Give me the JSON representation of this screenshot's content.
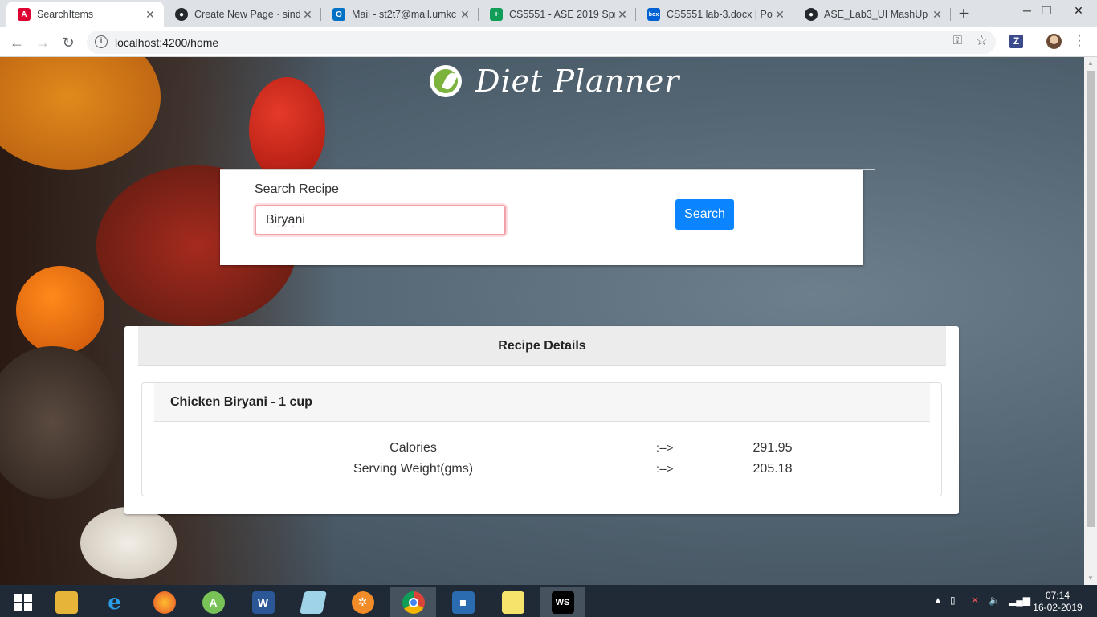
{
  "browser": {
    "tabs": [
      {
        "title": "SearchItems",
        "favicon": "angular-icon",
        "color": "#dd0031",
        "active": true
      },
      {
        "title": "Create New Page · sindh",
        "favicon": "github-icon",
        "color": "#24292e",
        "active": false
      },
      {
        "title": "Mail - st2t7@mail.umkc",
        "favicon": "outlook-icon",
        "color": "#0072c6",
        "active": false
      },
      {
        "title": "CS5551 - ASE 2019 Sprin",
        "favicon": "sheets-icon",
        "color": "#0f9d58",
        "active": false
      },
      {
        "title": "CS5551 lab-3.docx | Pow",
        "favicon": "box-icon",
        "color": "#0061d5",
        "active": false
      },
      {
        "title": "ASE_Lab3_UI MashUp · D",
        "favicon": "github-icon",
        "color": "#24292e",
        "active": false
      }
    ],
    "url": "localhost:4200/home"
  },
  "page": {
    "title": "Diet Planner",
    "search": {
      "label": "Search Recipe",
      "value": "Biryani",
      "button_label": "Search"
    },
    "details": {
      "header": "Recipe Details",
      "item_title": "Chicken Biryani - 1 cup",
      "rows": [
        {
          "label": "Calories",
          "arrow": ":-->",
          "value": "291.95"
        },
        {
          "label": "Serving Weight(gms)",
          "arrow": ":-->",
          "value": "205.18"
        }
      ]
    }
  },
  "taskbar": {
    "time": "07:14",
    "date": "16-02-2019"
  }
}
